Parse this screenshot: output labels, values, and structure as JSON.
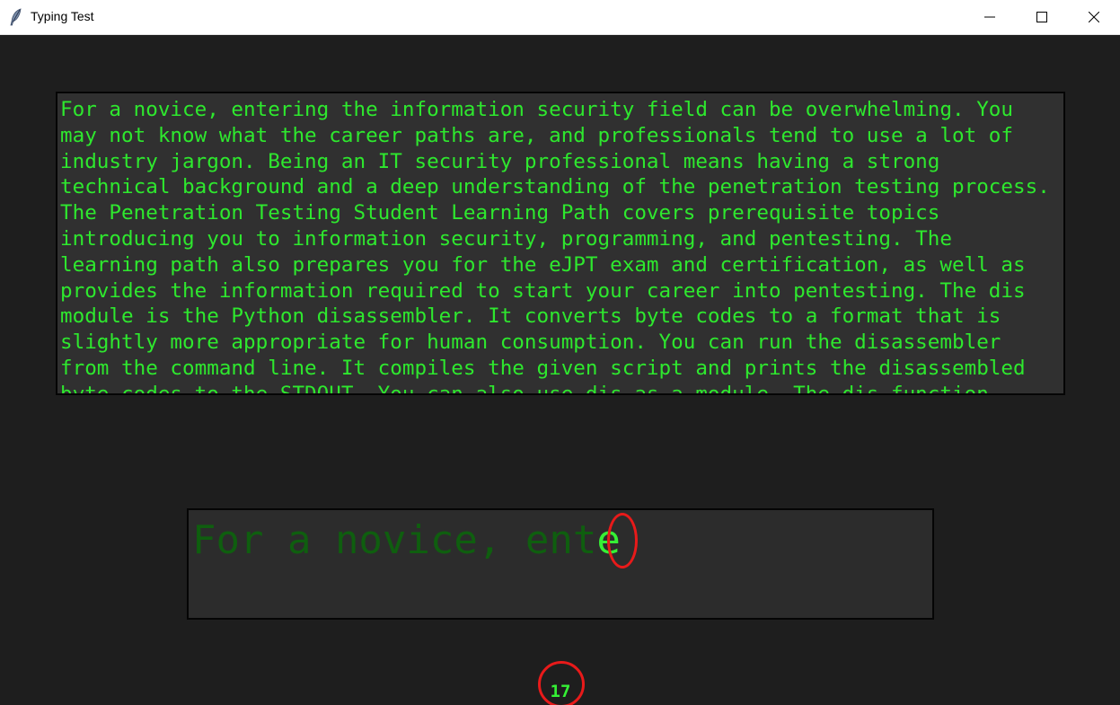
{
  "window": {
    "title": "Typing Test",
    "icons": {
      "app": "feather-icon",
      "minimize": "minimize-icon",
      "maximize": "maximize-icon",
      "close": "close-icon"
    }
  },
  "colors": {
    "background": "#1e1e1e",
    "panel": "#303030",
    "text_green": "#2ee82e",
    "typed_green": "#0f5e0f",
    "annotation_red": "#e81a1a"
  },
  "passage": {
    "text": "For a novice, entering the information security field can be overwhelming. You may not know what the career paths are, and professionals tend to use a lot of industry jargon. Being an IT security professional means having a strong technical background and a deep understanding of the penetration testing process. The Penetration Testing Student Learning Path covers prerequisite topics introducing you to information security, programming, and pentesting. The learning path also prepares you for the eJPT exam and certification, as well as provides the information required to start your career into pentesting. The dis module is the Python disassembler. It converts byte codes to a format that is slightly more appropriate for human consumption. You can run the disassembler from the command line. It compiles the given script and prints the disassembled byte codes to the STDOUT. You can also use dis as a module. The dis function"
  },
  "typing": {
    "typed": "For a novice, ent",
    "current_char": "e"
  },
  "counter": {
    "value": "17"
  }
}
